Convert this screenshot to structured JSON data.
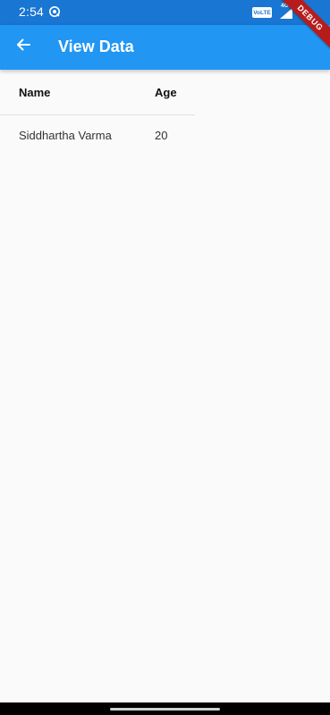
{
  "status_bar": {
    "time": "2:54",
    "volte_label": "VoLTE",
    "network_label": "4G",
    "colors": {
      "background": "#1976d2"
    }
  },
  "debug_banner": {
    "label": "DEBUG"
  },
  "app_bar": {
    "title": "View Data",
    "colors": {
      "background": "#2196f3",
      "text": "#ffffff"
    },
    "back_icon": "arrow-back-icon"
  },
  "table": {
    "headers": [
      "Name",
      "Age"
    ],
    "rows": [
      [
        "Siddhartha Varma",
        "20"
      ]
    ]
  }
}
